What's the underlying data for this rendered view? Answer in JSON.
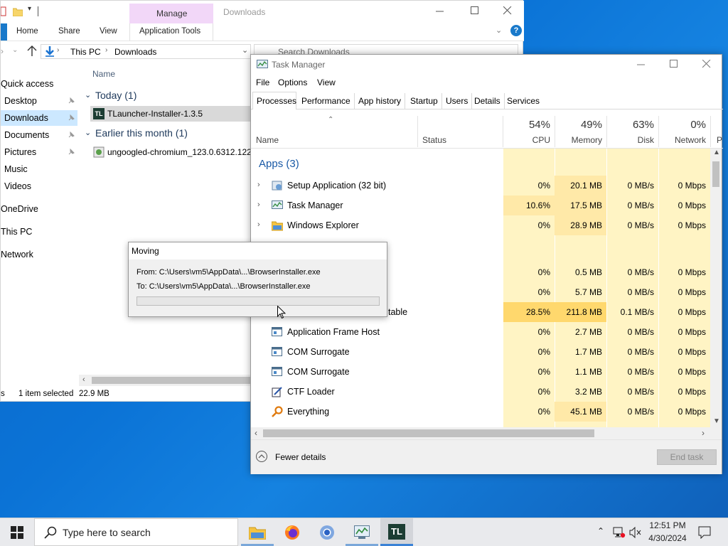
{
  "explorer": {
    "title": "Downloads",
    "manage_label": "Manage",
    "tabs": [
      "Home",
      "Share",
      "View",
      "Application Tools"
    ],
    "breadcrumb": [
      "This PC",
      "Downloads"
    ],
    "search_placeholder": "Search Downloads",
    "column_name": "Name",
    "nav": [
      {
        "label": "Quick access"
      },
      {
        "label": "Desktop"
      },
      {
        "label": "Downloads"
      },
      {
        "label": "Documents"
      },
      {
        "label": "Pictures"
      },
      {
        "label": "Music"
      },
      {
        "label": "Videos"
      },
      {
        "label": "OneDrive"
      },
      {
        "label": "This PC"
      },
      {
        "label": "Network"
      }
    ],
    "groups": [
      {
        "header": "Today (1)",
        "file": "TLauncher-Installer-1.3.5"
      },
      {
        "header": "Earlier this month (1)",
        "file": "ungoogled-chromium_123.0.6312.122-"
      }
    ],
    "status_prefix": "s",
    "status_selected": "1 item selected",
    "status_size": "22.9 MB"
  },
  "taskmgr": {
    "title": "Task Manager",
    "menu": [
      "File",
      "Options",
      "View"
    ],
    "tabs": [
      "Processes",
      "Performance",
      "App history",
      "Startup",
      "Users",
      "Details",
      "Services"
    ],
    "columns": {
      "name": "Name",
      "status": "Status",
      "cpu_pct": "54%",
      "cpu": "CPU",
      "mem_pct": "49%",
      "mem": "Memory",
      "disk_pct": "63%",
      "disk": "Disk",
      "net_pct": "0%",
      "net": "Network",
      "extra": "P"
    },
    "apps_header": "Apps (3)",
    "partial_group_suffix": ")",
    "partial_row_suffix": "table",
    "rows": [
      {
        "name": "Setup Application (32 bit)",
        "cpu": "0%",
        "mem": "20.1 MB",
        "disk": "0 MB/s",
        "net": "0 Mbps"
      },
      {
        "name": "Task Manager",
        "cpu": "10.6%",
        "mem": "17.5 MB",
        "disk": "0 MB/s",
        "net": "0 Mbps"
      },
      {
        "name": "Windows Explorer",
        "cpu": "0%",
        "mem": "28.9 MB",
        "disk": "0 MB/s",
        "net": "0 Mbps"
      },
      {
        "name": "",
        "cpu": "0%",
        "mem": "0.5 MB",
        "disk": "0 MB/s",
        "net": "0 Mbps"
      },
      {
        "name": "",
        "cpu": "0%",
        "mem": "5.7 MB",
        "disk": "0 MB/s",
        "net": "0 Mbps"
      },
      {
        "name": "",
        "cpu": "28.5%",
        "mem": "211.8 MB",
        "disk": "0.1 MB/s",
        "net": "0 Mbps"
      },
      {
        "name": "Application Frame Host",
        "cpu": "0%",
        "mem": "2.7 MB",
        "disk": "0 MB/s",
        "net": "0 Mbps"
      },
      {
        "name": "COM Surrogate",
        "cpu": "0%",
        "mem": "1.7 MB",
        "disk": "0 MB/s",
        "net": "0 Mbps"
      },
      {
        "name": "COM Surrogate",
        "cpu": "0%",
        "mem": "1.1 MB",
        "disk": "0 MB/s",
        "net": "0 Mbps"
      },
      {
        "name": "CTF Loader",
        "cpu": "0%",
        "mem": "3.2 MB",
        "disk": "0 MB/s",
        "net": "0 Mbps"
      },
      {
        "name": "Everything",
        "cpu": "0%",
        "mem": "45.1 MB",
        "disk": "0 MB/s",
        "net": "0 Mbps"
      }
    ],
    "fewer_details": "Fewer details",
    "end_task": "End task"
  },
  "moving": {
    "title": "Moving",
    "from": "From: C:\\Users\\vm5\\AppData\\...\\BrowserInstaller.exe",
    "to": "To: C:\\Users\\vm5\\AppData\\...\\BrowserInstaller.exe",
    "progress": 0
  },
  "taskbar": {
    "search_placeholder": "Type here to search",
    "tl_label": "TL",
    "time": "12:51 PM",
    "date": "4/30/2024"
  },
  "colors": {
    "accent": "#0078d7",
    "heat_low": "#fff4c4",
    "heat_mid": "#ffe9a8",
    "heat_high": "#ffd86d",
    "manage_tab": "#f2d7f8"
  }
}
